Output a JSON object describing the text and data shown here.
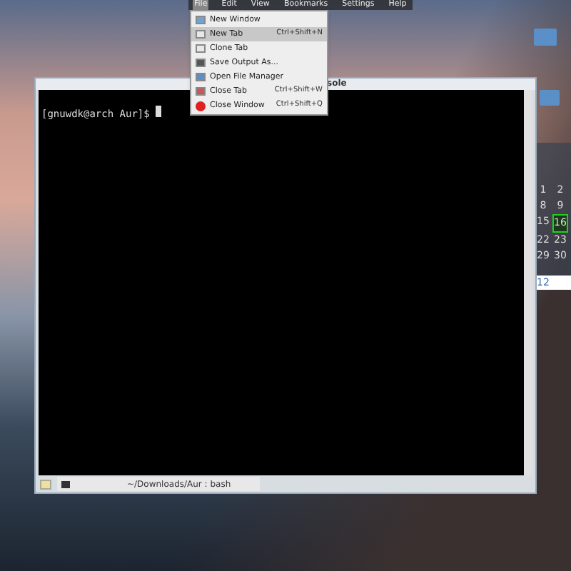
{
  "menu_bar": [
    {
      "label": "File",
      "selected": true
    },
    {
      "label": "Edit",
      "selected": false
    },
    {
      "label": "View",
      "selected": false
    },
    {
      "label": "Bookmarks",
      "selected": false
    },
    {
      "label": "Settings",
      "selected": false
    },
    {
      "label": "Help",
      "selected": false
    }
  ],
  "file_menu": [
    {
      "label": "New Window",
      "selected": false,
      "kind": "window"
    },
    {
      "label": "New Tab",
      "shortcut": "Ctrl+Shift+N",
      "selected": true,
      "kind": "tab"
    },
    {
      "label": "Clone Tab",
      "selected": false,
      "kind": "tab"
    },
    {
      "label": "Save Output As...",
      "selected": false,
      "kind": "save"
    },
    {
      "label": "Open File Manager",
      "selected": false,
      "kind": "folder"
    },
    {
      "label": "Close Tab",
      "shortcut": "Ctrl+Shift+W",
      "selected": false,
      "kind": "close-tab"
    },
    {
      "label": "Close Window",
      "shortcut": "Ctrl+Shift+Q",
      "selected": false,
      "kind": "close"
    }
  ],
  "window": {
    "title": "sole",
    "prompt": "[gnuwdk@arch Aur]$ ",
    "tabs": [
      {
        "label": "~/Downloads/Aur : bash",
        "selected": true
      }
    ]
  },
  "calendar": {
    "days": [
      {
        "label": "1",
        "selected": false
      },
      {
        "label": "2",
        "selected": false
      },
      {
        "label": "8",
        "selected": false
      },
      {
        "label": "9",
        "selected": false
      },
      {
        "label": "15",
        "selected": false
      },
      {
        "label": "16",
        "selected": true
      },
      {
        "label": "22",
        "selected": false
      },
      {
        "label": "23",
        "selected": false
      },
      {
        "label": "29",
        "selected": false
      },
      {
        "label": "30",
        "selected": false
      }
    ]
  },
  "clock_field": "12"
}
